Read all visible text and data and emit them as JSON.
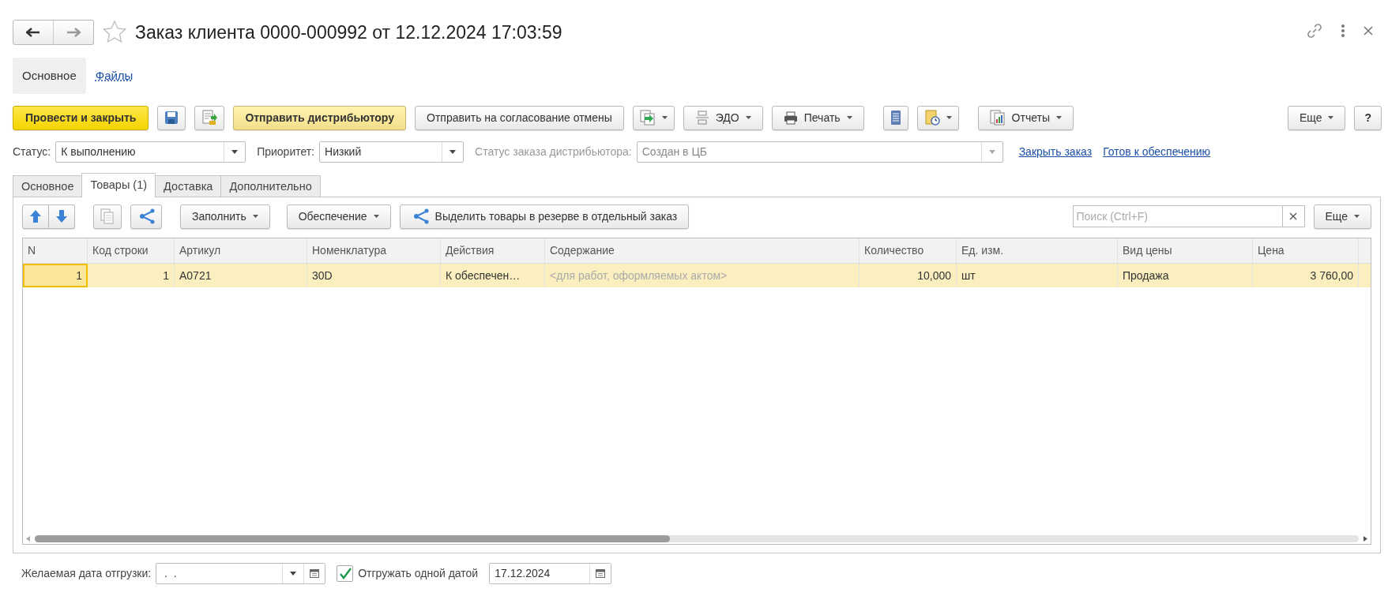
{
  "window": {
    "title": "Заказ клиента 0000-000992 от 12.12.2024 17:03:59"
  },
  "sections": [
    {
      "label": "Основное",
      "selected": true
    },
    {
      "label": "Файлы",
      "selected": false
    }
  ],
  "toolbar": {
    "post_button": "Провести и закрыть",
    "send_distributor_button": "Отправить дистрибьютору",
    "cancel_approval_button": "Отправить на согласование отмены",
    "edo_button": "ЭДО",
    "print_button": "Печать",
    "reports_button": "Отчеты",
    "more_button": "Еще",
    "help_button": "?"
  },
  "fields": [
    {
      "label": "Статус:",
      "value": "К выполнению",
      "disabled": false
    },
    {
      "label": "Приоритет:",
      "value": "Низкий",
      "disabled": false
    },
    {
      "label": "Статус заказа дистрибьютора:",
      "value": "Создан в ЦБ",
      "disabled": true
    }
  ],
  "links": [
    "Закрыть заказ",
    "Готов к обеспечению"
  ],
  "tabs": [
    {
      "label": "Основное",
      "selected": false
    },
    {
      "label": "Товары (1)",
      "selected": true
    },
    {
      "label": "Доставка",
      "selected": false
    },
    {
      "label": "Дополнительно",
      "selected": false
    }
  ],
  "table_toolbar": {
    "fill_button": "Заполнить",
    "supply_button": "Обеспечение",
    "split_button": "Выделить товары в резерве в отдельный заказ",
    "search": {
      "placeholder": "Поиск (Ctrl+F)"
    },
    "more_button": "Еще"
  },
  "table": {
    "columns": [
      "N",
      "Код строки",
      "Артикул",
      "Номенклатура",
      "Действия",
      "Содержание",
      "Количество",
      "Ед. изм.",
      "Вид цены",
      "Цена"
    ],
    "rows": [
      {
        "selected": true,
        "cells": [
          {
            "text": "1",
            "hint": false,
            "focused": true
          },
          {
            "text": "1",
            "hint": false,
            "focused": false
          },
          {
            "text": "A0721",
            "hint": false,
            "focused": false
          },
          {
            "text": "30D",
            "hint": false,
            "focused": false
          },
          {
            "text": "К обеспечен…",
            "hint": false,
            "focused": false
          },
          {
            "text": "<для работ, оформляемых актом>",
            "hint": true,
            "focused": false
          },
          {
            "text": "10,000",
            "hint": false,
            "focused": false
          },
          {
            "text": "шт",
            "hint": false,
            "focused": false
          },
          {
            "text": "Продажа",
            "hint": false,
            "focused": false
          },
          {
            "text": "3 760,00",
            "hint": false,
            "focused": false
          }
        ]
      }
    ]
  },
  "footer": {
    "desired_date": {
      "label": "Желаемая дата отгрузки:",
      "value": " .  ."
    },
    "single_date": {
      "label": "Отгружать одной датой",
      "checked": true
    },
    "ship_date": "17.12.2024"
  }
}
